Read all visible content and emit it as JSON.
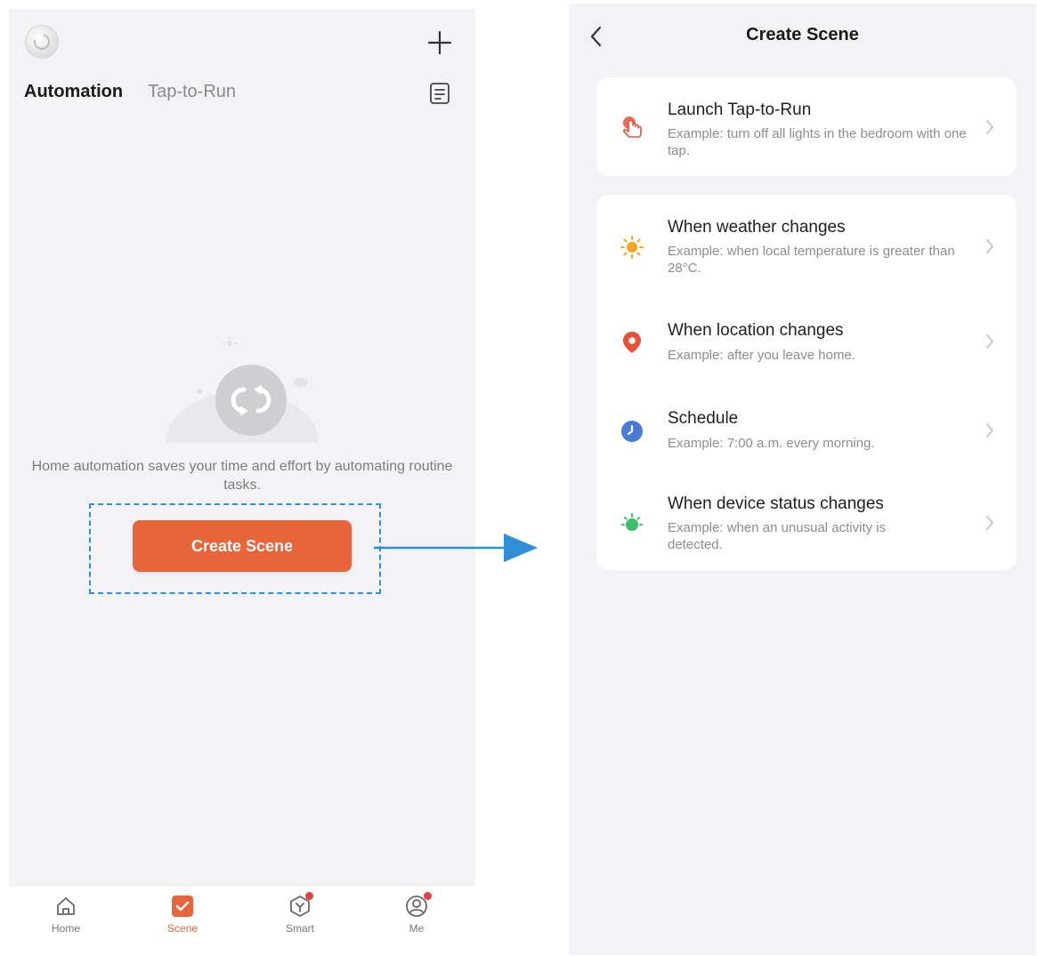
{
  "left_screen": {
    "tabs": [
      {
        "label": "Automation",
        "active": true
      },
      {
        "label": "Tap-to-Run",
        "active": false
      }
    ],
    "empty_state_text": "Home automation saves your time and effort by automating routine tasks.",
    "create_button_label": "Create Scene",
    "bottom_nav": [
      {
        "label": "Home",
        "icon": "home-icon",
        "active": false,
        "badge": false
      },
      {
        "label": "Scene",
        "icon": "scene-check-icon",
        "active": true,
        "badge": false
      },
      {
        "label": "Smart",
        "icon": "smart-icon",
        "active": false,
        "badge": true
      },
      {
        "label": "Me",
        "icon": "profile-icon",
        "active": false,
        "badge": true
      }
    ]
  },
  "right_screen": {
    "title": "Create Scene",
    "tap_to_run_option": {
      "title": "Launch Tap-to-Run",
      "description": "Example: turn off all lights in the bedroom with one tap.",
      "icon": "tap-hand-icon"
    },
    "automation_options": [
      {
        "title": "When weather changes",
        "description": "Example: when local temperature is greater than 28°C.",
        "icon": "sun-icon"
      },
      {
        "title": "When location changes",
        "description": "Example: after you leave home.",
        "icon": "location-pin-icon"
      },
      {
        "title": "Schedule",
        "description": "Example: 7:00 a.m. every morning.",
        "icon": "clock-icon"
      },
      {
        "title": "When device status changes",
        "description": "Example: when an unusual activity is detected.",
        "icon": "device-status-icon"
      }
    ]
  },
  "colors": {
    "accent": "#e8643a",
    "highlight": "#2f8fd8",
    "background": "#f3f3f5",
    "card": "#ffffff",
    "weather": "#f5a623",
    "location": "#e8503a",
    "schedule": "#4a7bd6",
    "device": "#3cbf6a"
  }
}
